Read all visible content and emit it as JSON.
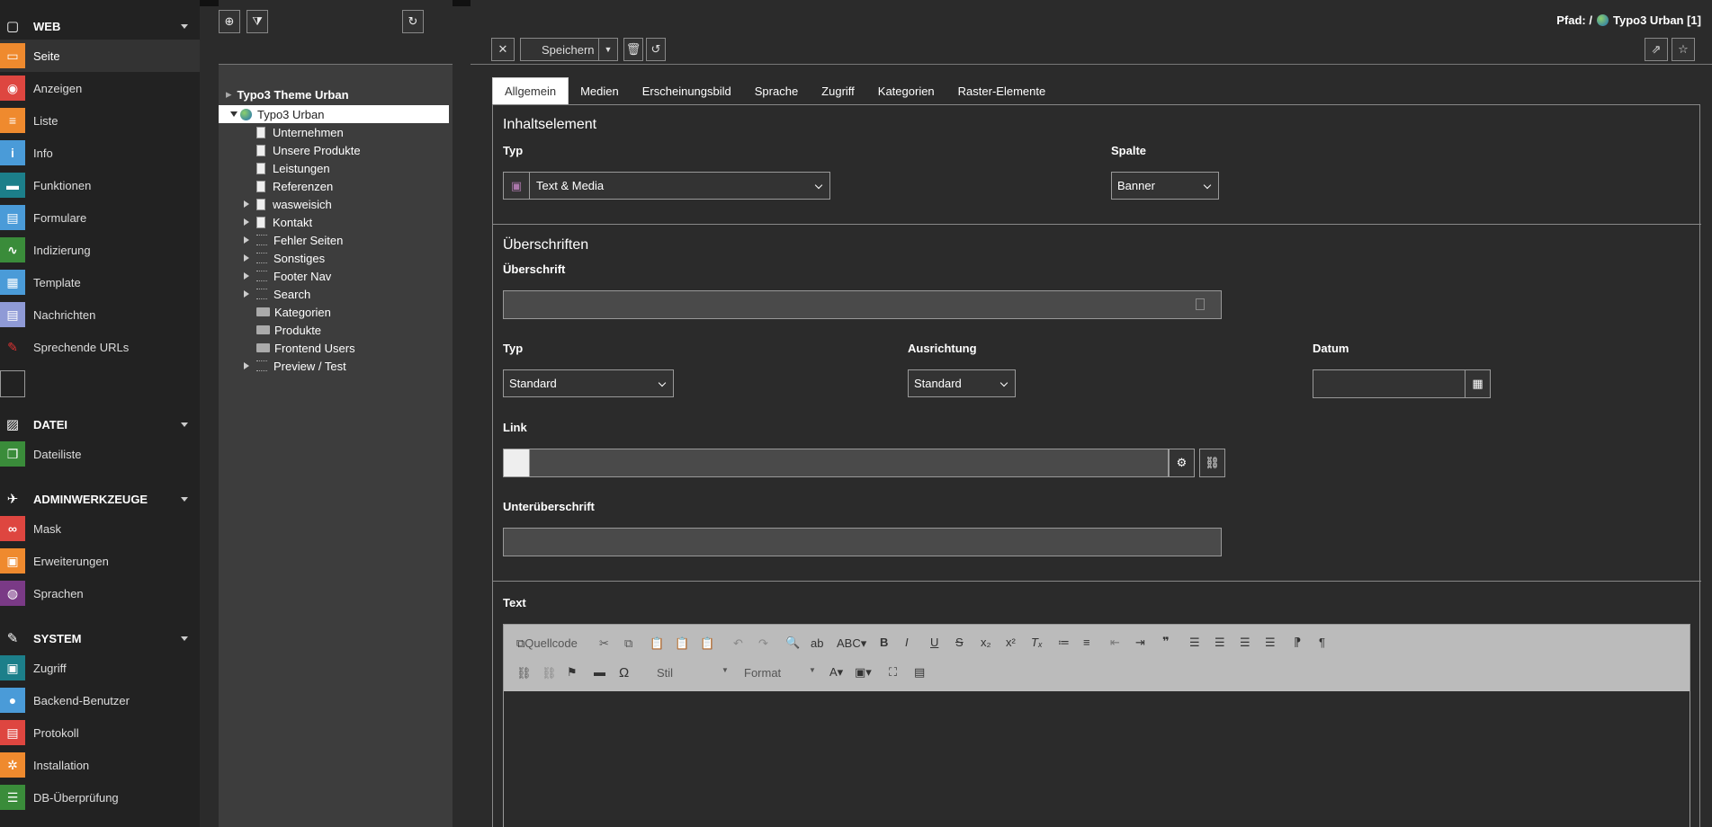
{
  "modules": {
    "web": {
      "label": "WEB",
      "items": [
        {
          "label": "Seite",
          "icon": "page-icon",
          "color": "#ef8a2e"
        },
        {
          "label": "Anzeigen",
          "icon": "eye-icon",
          "color": "#de4640"
        },
        {
          "label": "Liste",
          "icon": "list-icon",
          "color": "#ef8a2e"
        },
        {
          "label": "Info",
          "icon": "info-icon",
          "color": "#4a9bd8"
        },
        {
          "label": "Funktionen",
          "icon": "briefcase-icon",
          "color": "#1c7f8a"
        },
        {
          "label": "Formulare",
          "icon": "form-icon",
          "color": "#4a9bd8"
        },
        {
          "label": "Indizierung",
          "icon": "chart-icon",
          "color": "#3a8c3a"
        },
        {
          "label": "Template",
          "icon": "template-icon",
          "color": "#4a9bd8"
        },
        {
          "label": "Nachrichten",
          "icon": "news-icon",
          "color": "#8f9ad6"
        },
        {
          "label": "Sprechende URLs",
          "icon": "syringe-icon",
          "color": "#222"
        }
      ]
    },
    "datei": {
      "label": "DATEI",
      "items": [
        {
          "label": "Dateiliste",
          "icon": "files-icon",
          "color": "#3a8c3a"
        }
      ]
    },
    "admin": {
      "label": "ADMINWERKZEUGE",
      "items": [
        {
          "label": "Mask",
          "icon": "mask-icon",
          "color": "#de4640"
        },
        {
          "label": "Erweiterungen",
          "icon": "box-icon",
          "color": "#ef8a2e"
        },
        {
          "label": "Sprachen",
          "icon": "globe-icon",
          "color": "#7a3a86"
        }
      ]
    },
    "system": {
      "label": "SYSTEM",
      "items": [
        {
          "label": "Zugriff",
          "icon": "lock-icon",
          "color": "#1c7f8a"
        },
        {
          "label": "Backend-Benutzer",
          "icon": "user-icon",
          "color": "#4a9bd8"
        },
        {
          "label": "Protokoll",
          "icon": "log-icon",
          "color": "#de4640"
        },
        {
          "label": "Installation",
          "icon": "install-icon",
          "color": "#ef8a2e"
        },
        {
          "label": "DB-Überprüfung",
          "icon": "db-icon",
          "color": "#3a8c3a"
        }
      ]
    }
  },
  "tree": {
    "root": "Typo3 Theme Urban",
    "site": "Typo3 Urban",
    "nodes": [
      {
        "label": "Unternehmen",
        "kind": "page",
        "expandable": false
      },
      {
        "label": "Unsere Produkte",
        "kind": "page",
        "expandable": false
      },
      {
        "label": "Leistungen",
        "kind": "page",
        "expandable": false
      },
      {
        "label": "Referenzen",
        "kind": "page",
        "expandable": false
      },
      {
        "label": "wasweisich",
        "kind": "page",
        "expandable": true
      },
      {
        "label": "Kontakt",
        "kind": "page",
        "expandable": true
      },
      {
        "label": "Fehler Seiten",
        "kind": "sep",
        "expandable": true
      },
      {
        "label": "Sonstiges",
        "kind": "sep",
        "expandable": true
      },
      {
        "label": "Footer Nav",
        "kind": "sep",
        "expandable": true
      },
      {
        "label": "Search",
        "kind": "sep",
        "expandable": true
      },
      {
        "label": "Kategorien",
        "kind": "folder",
        "expandable": false
      },
      {
        "label": "Produkte",
        "kind": "folder",
        "expandable": false
      },
      {
        "label": "Frontend Users",
        "kind": "folder",
        "expandable": false
      },
      {
        "label": "Preview / Test",
        "kind": "sep",
        "expandable": true
      }
    ]
  },
  "docheader": {
    "path_label": "Pfad: /",
    "path_page": "Typo3 Urban [1]",
    "save_label": "Speichern"
  },
  "tabs": [
    "Allgemein",
    "Medien",
    "Erscheinungsbild",
    "Sprache",
    "Zugriff",
    "Kategorien",
    "Raster-Elemente"
  ],
  "form": {
    "section1": "Inhaltselement",
    "typ_label": "Typ",
    "typ_value": "Text & Media",
    "spalte_label": "Spalte",
    "spalte_value": "Banner",
    "section2": "Überschriften",
    "header_label": "Überschrift",
    "header_value": "",
    "htyp_label": "Typ",
    "htyp_value": "Standard",
    "align_label": "Ausrichtung",
    "align_value": "Standard",
    "date_label": "Datum",
    "date_value": "",
    "link_label": "Link",
    "link_value": "",
    "sub_label": "Unterüberschrift",
    "sub_value": "",
    "text_label": "Text"
  },
  "rte": {
    "source": "Quellcode",
    "stil": "Stil",
    "format": "Format"
  }
}
